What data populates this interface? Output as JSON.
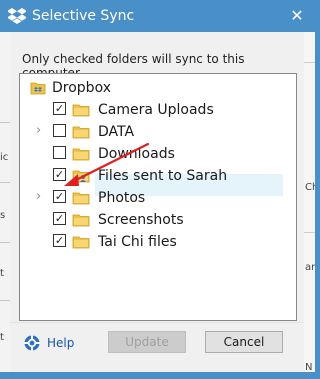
{
  "window": {
    "title": "Selective Sync",
    "close_glyph": "✕"
  },
  "dialog": {
    "instruction": "Only checked folders will sync to this computer.",
    "root": {
      "label": "Dropbox",
      "icon": "dropbox-folder-icon"
    },
    "folders": [
      {
        "label": "Camera Uploads",
        "checked": true,
        "check_glyph": "✓",
        "has_children": false
      },
      {
        "label": "DATA",
        "checked": false,
        "check_glyph": "",
        "has_children": true,
        "expander_glyph": "›"
      },
      {
        "label": "Downloads",
        "checked": false,
        "check_glyph": "",
        "has_children": false,
        "highlighted": true
      },
      {
        "label": "Files sent to Sarah",
        "checked": true,
        "check_glyph": "✓",
        "has_children": false,
        "shared": true
      },
      {
        "label": "Photos",
        "checked": true,
        "check_glyph": "✓",
        "has_children": true,
        "expander_glyph": "›"
      },
      {
        "label": "Screenshots",
        "checked": true,
        "check_glyph": "✓",
        "has_children": false
      },
      {
        "label": "Tai  Chi files",
        "checked": true,
        "check_glyph": "✓",
        "has_children": false
      }
    ],
    "annotation": {
      "type": "red-arrow",
      "target": "Downloads",
      "color": "#e02020"
    }
  },
  "footer": {
    "help_label": "Help",
    "update_label": "Update",
    "update_enabled": false,
    "cancel_label": "Cancel"
  },
  "colors": {
    "titlebar": "#4a90c8",
    "dialog_bg": "#f0f0f0",
    "folder": "#f0c24a",
    "highlight": "#e5f3fb",
    "link": "#1a54a8"
  }
}
